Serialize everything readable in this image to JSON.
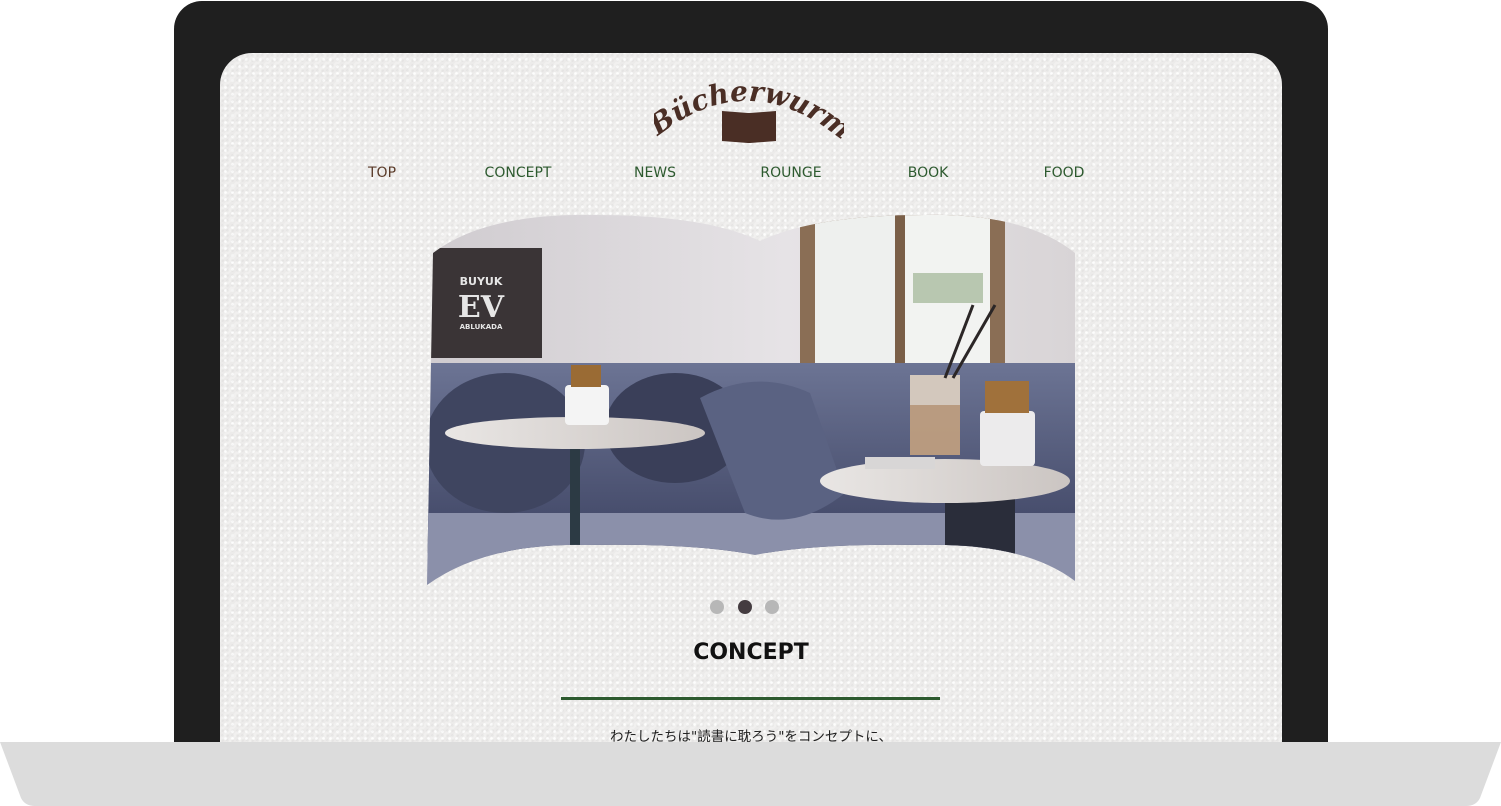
{
  "site": {
    "logo_text": "Bücherwurm"
  },
  "nav": {
    "items": [
      {
        "label": "TOP"
      },
      {
        "label": "CONCEPT"
      },
      {
        "label": "NEWS"
      },
      {
        "label": "ROUNGE"
      },
      {
        "label": "BOOK"
      },
      {
        "label": "FOOD"
      }
    ]
  },
  "hero": {
    "poster_lines": [
      "BUYUK",
      "EV",
      "ABLUKADA"
    ],
    "slide_count": 3,
    "active_slide": 2
  },
  "concept": {
    "title": "CONCEPT",
    "intro": "わたしたちは\"読書に耽ろう\"をコンセプトに、"
  },
  "colors": {
    "accent_green": "#2d5a2f",
    "brand_brown": "#5a3a28",
    "bezel": "#1f1f1f"
  }
}
